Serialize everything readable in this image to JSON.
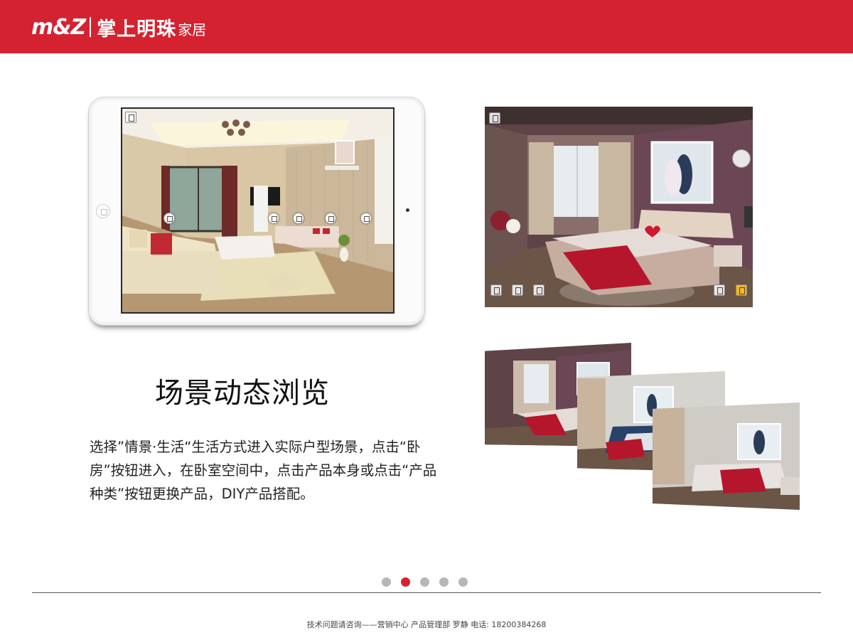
{
  "brand": {
    "mark": "m&Z",
    "name": "掌上明珠",
    "suffix": "家居"
  },
  "section": {
    "title": "场景动态浏览",
    "description": "选择”情景·生活“生活方式进入实际户型场景，点击“卧房”按钮进入，在卧室空间中，点击产品本身或点击“产品种类”按钮更换产品，DIY产品搭配。"
  },
  "colors": {
    "brand_red": "#d42230",
    "dot_inactive": "#b7b7b7"
  },
  "pagination": {
    "count": 5,
    "active_index": 1
  },
  "footer": {
    "text": "技术问题请咨询——营销中心 产品管理部  罗静 电话: 18200384268"
  },
  "icons": {
    "exit": "exit-icon",
    "home": "home-icon",
    "layers": "layers-icon",
    "cart": "cart-icon",
    "menu": "menu-icon"
  }
}
